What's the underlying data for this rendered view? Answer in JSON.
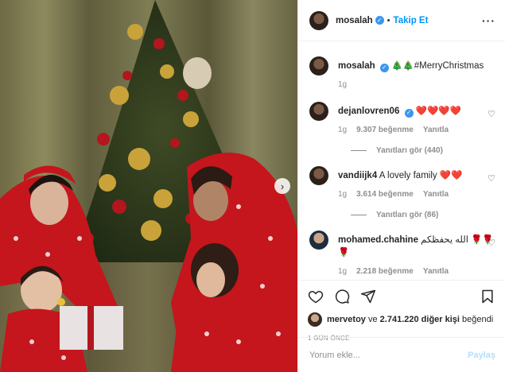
{
  "post": {
    "author": "mosalah",
    "follow_label": "Takip Et",
    "more_icon": "more-horizontal-icon",
    "caption": "🎄🎄#MerryChristmas",
    "caption_age": "1g",
    "carousel_next_icon": "chevron-right-icon"
  },
  "comments": [
    {
      "username": "dejanlovren06",
      "verified": true,
      "text": "❤️❤️❤️❤️",
      "age": "1g",
      "likes": "9.307 beğenme",
      "reply_label": "Yanıtla",
      "replies_label": "Yanıtları gör (440)"
    },
    {
      "username": "vandiijk4",
      "verified": false,
      "text": "A lovely family ❤️❤️",
      "age": "1g",
      "likes": "3.614 beğenme",
      "reply_label": "Yanıtla",
      "replies_label": "Yanıtları gör (86)"
    },
    {
      "username": "mohamed.chahine",
      "verified": false,
      "text": "الله يحفظكم 🌹🌹🌹",
      "age": "1g",
      "likes": "2.218 beğenme",
      "reply_label": "Yanıtla"
    }
  ],
  "liked_by": {
    "user": "mervetoy",
    "connector": "ve",
    "count_text": "2.741.220 diğer kişi",
    "suffix": "beğendi"
  },
  "time_ago": "1 GÜN ÖNCE",
  "comment_box": {
    "placeholder": "Yorum ekle...",
    "share_label": "Paylaş"
  },
  "colors": {
    "link_blue": "#0095f6",
    "verified_blue": "#3897f0",
    "muted": "#8e8e8e",
    "heart_red": "#ed1c24"
  }
}
